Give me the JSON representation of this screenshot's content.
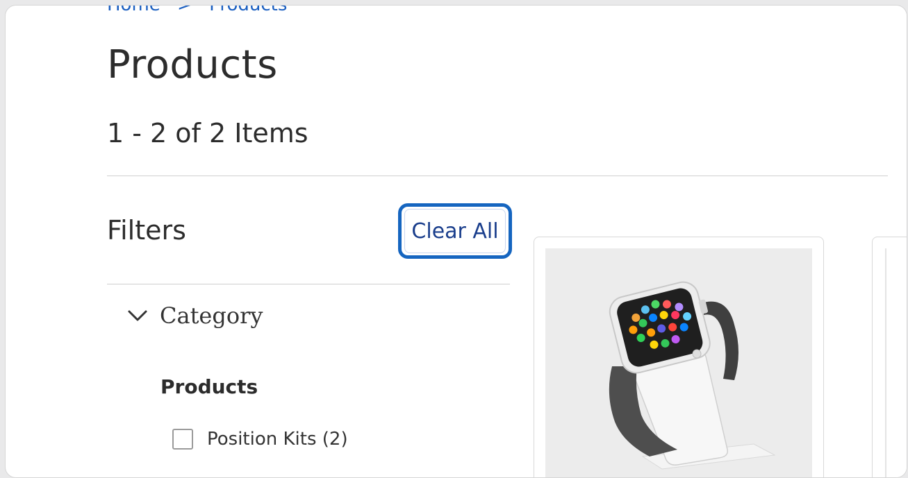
{
  "breadcrumb": {
    "home": "Home",
    "separator": ">",
    "current": "Products"
  },
  "page": {
    "title": "Products",
    "item_count": "1 - 2 of 2 Items"
  },
  "filters": {
    "heading": "Filters",
    "clear_all_label": "Clear All",
    "category": {
      "label": "Category",
      "expanded": true,
      "subheading": "Products",
      "options": [
        {
          "label": "Position Kits (2)",
          "checked": false
        }
      ]
    }
  },
  "products": [
    {
      "image": "smartwatch-charging-stand-icon"
    },
    {
      "image": "product-image-partial"
    }
  ],
  "colors": {
    "link": "#1b5fc1",
    "focus_ring": "#1565c0",
    "button_text": "#1a3e8c",
    "text": "#2c2c2c"
  }
}
